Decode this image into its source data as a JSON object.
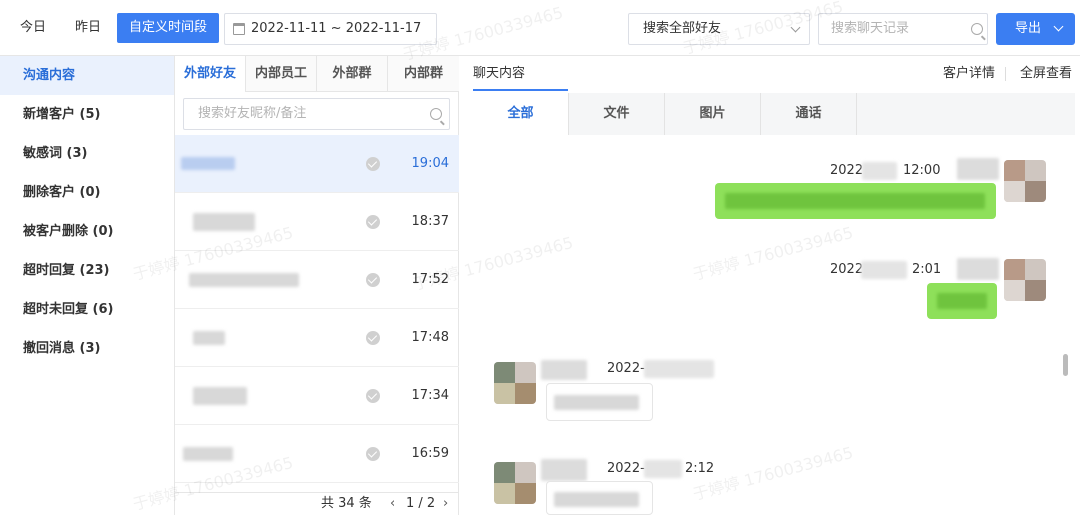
{
  "topbar": {
    "today": "今日",
    "yesterday": "昨日",
    "custom_range": "自定义时间段",
    "date_range": "2022-11-11 ~ 2022-11-17",
    "friend_scope": "搜索全部好友",
    "chat_search_placeholder": "搜索聊天记录",
    "export": "导出"
  },
  "sidebar": {
    "items": [
      {
        "label": "沟通内容"
      },
      {
        "label": "新增客户 (5)"
      },
      {
        "label": "敏感词 (3)"
      },
      {
        "label": "删除客户 (0)"
      },
      {
        "label": "被客户删除 (0)"
      },
      {
        "label": "超时回复 (23)"
      },
      {
        "label": "超时未回复 (6)"
      },
      {
        "label": "撤回消息 (3)"
      }
    ]
  },
  "friends": {
    "tabs": [
      "外部好友",
      "内部员工",
      "外部群",
      "内部群"
    ],
    "search_placeholder": "搜索好友昵称/备注",
    "rows": [
      {
        "time": "19:04"
      },
      {
        "time": "18:37"
      },
      {
        "time": "17:52"
      },
      {
        "time": "17:48"
      },
      {
        "time": "17:34"
      },
      {
        "time": "16:59"
      }
    ],
    "pager": {
      "total": "共 34 条",
      "page": "1 / 2"
    }
  },
  "chat": {
    "title": "聊天内容",
    "customer_detail": "客户详情",
    "fullscreen": "全屏查看",
    "tabs": [
      "全部",
      "文件",
      "图片",
      "通话"
    ],
    "messages": [
      {
        "ts_prefix": "2022",
        "ts_suffix": "12:00"
      },
      {
        "ts_prefix": "2022",
        "ts_suffix": "2:01"
      },
      {
        "ts_prefix": "2022-",
        "ts_suffix": ""
      },
      {
        "ts_prefix": "2022-",
        "ts_suffix": "2:12"
      }
    ]
  },
  "watermark": "于婷婷 17600339465"
}
